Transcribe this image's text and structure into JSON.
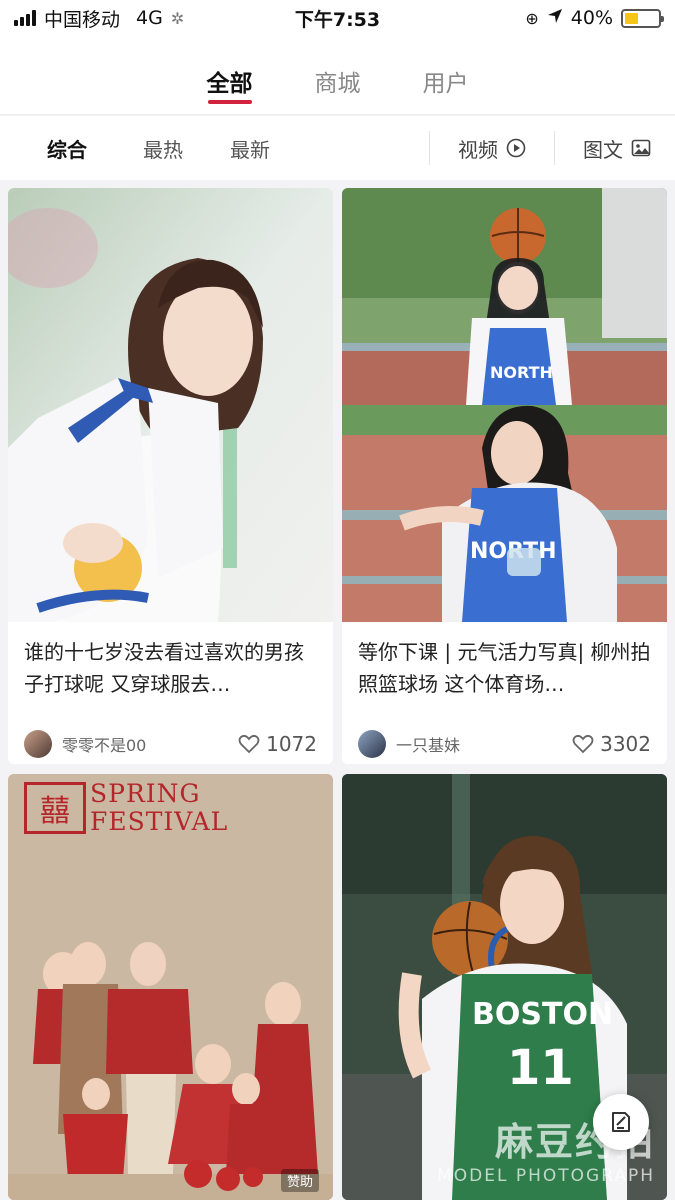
{
  "status_bar": {
    "carrier": "中国移动",
    "network": "4G",
    "time": "下午7:53",
    "battery": "40%",
    "battery_level": 0.4
  },
  "top_tabs": [
    {
      "label": "全部",
      "active": true
    },
    {
      "label": "商城",
      "active": false
    },
    {
      "label": "用户",
      "active": false
    }
  ],
  "filters": {
    "sort": [
      {
        "label": "综合",
        "active": true
      },
      {
        "label": "最热",
        "active": false
      },
      {
        "label": "最新",
        "active": false
      }
    ],
    "video": "视频",
    "image_text": "图文"
  },
  "cards": [
    {
      "title": "谁的十七岁没去看过喜欢的男孩子打球呢 又穿球服去…",
      "author": "零零不是00",
      "likes": "1072"
    },
    {
      "title": "等你下课 | 元气活力写真| 柳州拍照篮球场 这个体育场…",
      "author": "一只基妹",
      "likes": "3302"
    },
    {
      "spring_line1": "SPRING",
      "spring_line2": "FESTIVAL",
      "sponsor": "赞助"
    },
    {
      "watermark_main": "麻豆约拍",
      "watermark_sub": "MODEL PHOTOGRAPH"
    }
  ],
  "colors": {
    "accent": "#d1233c",
    "festival_red": "#b5262b",
    "jersey_blue": "#2f5bb5",
    "jersey_green": "#2e7d4a"
  }
}
